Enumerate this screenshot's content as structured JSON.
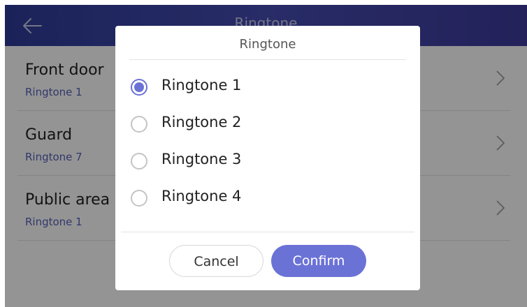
{
  "topbar": {
    "title": "Ringtone"
  },
  "list": {
    "items": [
      {
        "title": "Front door",
        "value": "Ringtone 1"
      },
      {
        "title": "Guard",
        "value": "Ringtone 7"
      },
      {
        "title": "Public area",
        "value": "Ringtone 1"
      }
    ]
  },
  "dialog": {
    "title": "Ringtone",
    "options": [
      {
        "label": "Ringtone 1",
        "selected": true
      },
      {
        "label": "Ringtone 2",
        "selected": false
      },
      {
        "label": "Ringtone 3",
        "selected": false
      },
      {
        "label": "Ringtone 4",
        "selected": false
      }
    ],
    "cancel_label": "Cancel",
    "confirm_label": "Confirm"
  },
  "colors": {
    "accent": "#6b72d6",
    "topbar_start": "#2f3c9a",
    "topbar_end": "#3e3a9c",
    "subtitle": "#5661b8"
  }
}
